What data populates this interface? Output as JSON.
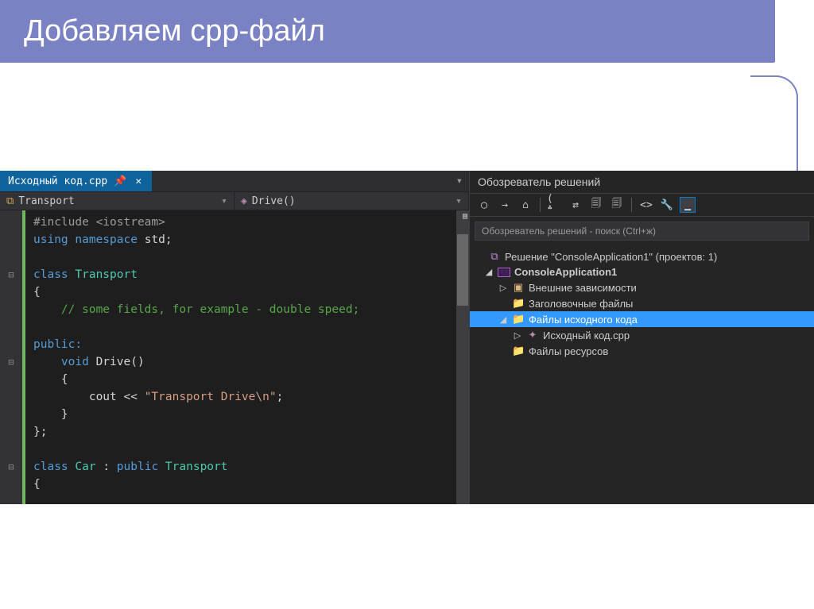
{
  "slide": {
    "title": "Добавляем срр-файл"
  },
  "editor": {
    "tab_name": "Исходный код.cpp",
    "nav_class": "Transport",
    "nav_member": "Drive()",
    "code": {
      "l1a": "#include",
      "l1b": "<iostream>",
      "l2a": "using",
      "l2b": "namespace",
      "l2c": "std;",
      "l4a": "class",
      "l4b": "Transport",
      "l5": "{",
      "l6": "    // some fields, for example - double speed;",
      "l8a": "public:",
      "l9a": "    void",
      "l9b": "Drive()",
      "l10": "    {",
      "l11a": "        cout << ",
      "l11b": "\"Transport Drive\\n\"",
      "l11c": ";",
      "l12": "    }",
      "l13": "};",
      "l15a": "class",
      "l15b": "Car",
      "l15c": ":",
      "l15d": "public",
      "l15e": "Transport",
      "l16": "{"
    }
  },
  "explorer": {
    "title": "Обозреватель решений",
    "search_placeholder": "Обозреватель решений - поиск (Ctrl+ж)",
    "solution_prefix": "Решение \"",
    "solution_name": "ConsoleApplication1",
    "solution_suffix": "\" (проектов: 1)",
    "project": "ConsoleApplication1",
    "node_deps": "Внешние зависимости",
    "node_headers": "Заголовочные файлы",
    "node_source": "Файлы исходного кода",
    "node_file": "Исходный код.cpp",
    "node_res": "Файлы ресурсов"
  }
}
